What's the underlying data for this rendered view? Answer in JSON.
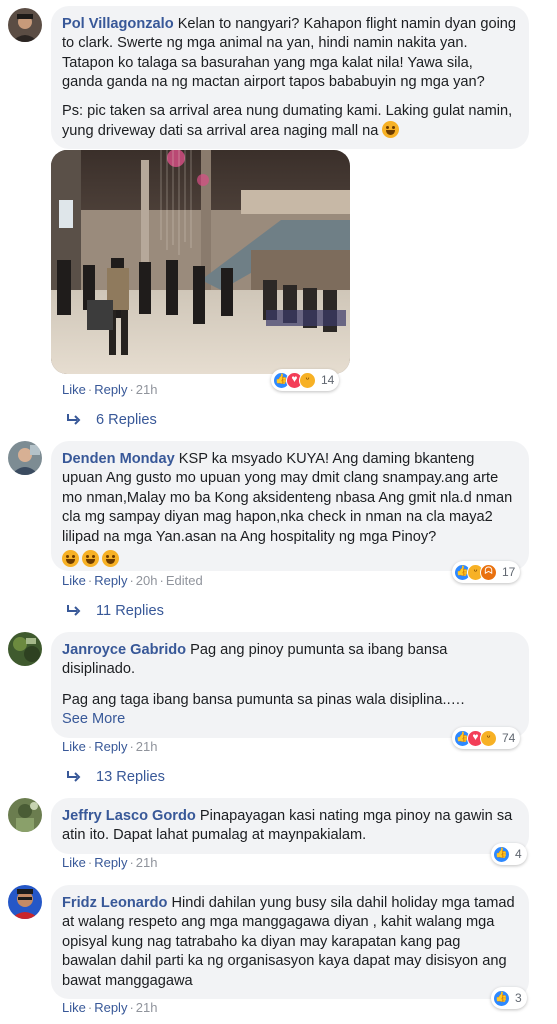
{
  "comments": [
    {
      "author": "Pol Villagonzalo",
      "text_first": "Kelan to nangyari? Kahapon flight namin dyan going to clark. Swerte ng mga animal na yan, hindi namin nakita yan. Tatapon ko talaga sa basurahan yang mga kalat nila! Yawa sila, ganda ganda na ng mactan airport tapos bababuyin ng mga yan?",
      "text_second": "Ps: pic taken sa arrival area nung dumating kami. Laking gulat namin, yung driveway dati sa arrival area naging mall na",
      "like": "Like",
      "reply": "Reply",
      "time": "21h",
      "reaction_count": "14",
      "reactions": [
        "like",
        "love",
        "haha"
      ],
      "replies": "6 Replies"
    },
    {
      "author": "Denden Monday",
      "text": "KSP ka msyado KUYA! Ang daming bkanteng upuan Ang gusto mo upuan yong may dmit clang snampay.ang arte mo nman,Malay mo ba Kong aksidenteng nbasa Ang gmit nla.d nman cla mg sampay diyan mag hapon,nka check in nman na cla maya2 lilipad na mga Yan.asan na Ang hospitality ng mga Pinoy?",
      "like": "Like",
      "reply": "Reply",
      "time": "20h",
      "edited": "Edited",
      "reaction_count": "17",
      "reactions": [
        "like",
        "haha",
        "angry"
      ],
      "replies": "11 Replies"
    },
    {
      "author": "Janroyce Gabrido",
      "text_first": "Pag ang pinoy pumunta sa ibang bansa disiplinado.",
      "text_second": "Pag ang taga ibang bansa pumunta sa pinas wala disiplina..…",
      "see_more": "See More",
      "like": "Like",
      "reply": "Reply",
      "time": "21h",
      "reaction_count": "74",
      "reactions": [
        "like",
        "love",
        "haha"
      ],
      "replies": "13 Replies"
    },
    {
      "author": "Jeffry Lasco Gordo",
      "text": "Pinapayagan kasi nating mga pinoy na gawin sa atin ito. Dapat lahat pumalag at maynpakialam.",
      "like": "Like",
      "reply": "Reply",
      "time": "21h",
      "reaction_count": "4",
      "reactions": [
        "like"
      ]
    },
    {
      "author": "Fridz Leonardo",
      "text": "Hindi dahilan yung busy sila dahil holiday mga tamad at walang respeto ang mga manggagawa diyan , kahit walang mga opisyal kung nag tatrabaho ka diyan may karapatan kang pag bawalan dahil parti ka ng organisasyon kaya dapat may disisyon ang bawat manggagawa",
      "like": "Like",
      "reply": "Reply",
      "time": "21h",
      "reaction_count": "3",
      "reactions": [
        "like"
      ]
    }
  ],
  "icons": {
    "like": "thumbs-up-icon",
    "love": "heart-icon",
    "haha": "laughing-face-icon",
    "angry": "angry-face-icon",
    "reply_arrow": "reply-arrow-icon"
  },
  "colors": {
    "link": "#385898",
    "bubble": "#f2f3f5",
    "like": "#2e89ff",
    "love": "#f33e58",
    "haha": "#f7b125",
    "angry": "#e9710f"
  }
}
